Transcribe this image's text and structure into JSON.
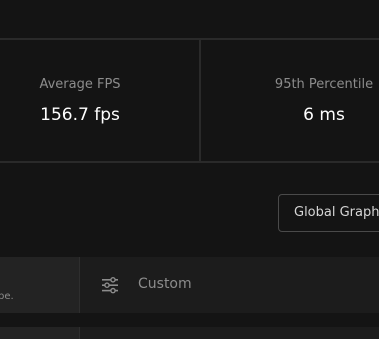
{
  "stats": {
    "average_fps": {
      "label": "Average FPS",
      "value": "156.7 fps"
    },
    "percentile_95": {
      "label": "95th Percentile",
      "value": "6 ms"
    }
  },
  "global_button": {
    "label": "Global Graphi"
  },
  "preset_row": {
    "left_text_fragment": "pe.",
    "icon": "sliders-icon",
    "label": "Custom"
  },
  "colors": {
    "background": "#141414",
    "divider": "#2a2a2a",
    "label_gray": "#8c8c8c",
    "value_white": "#ffffff",
    "row_background": "#1c1c1c"
  }
}
